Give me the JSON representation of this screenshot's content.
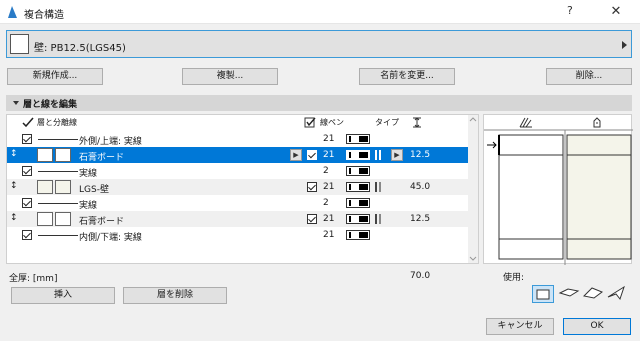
{
  "window": {
    "title": "複合構造",
    "help": "?",
    "close": "✕"
  },
  "selector": {
    "name": "壁: PB12.5(LGS45)"
  },
  "buttons": {
    "new": "新規作成...",
    "duplicate": "複製...",
    "rename": "名前を変更...",
    "delete": "削除..."
  },
  "section": {
    "title": "層と線を編集"
  },
  "columns": {
    "layer": "層と分離線",
    "pen": "線ペン",
    "type": "タイプ",
    "thickness_icon": "thickness-icon"
  },
  "rows": [
    {
      "kind": "line",
      "label": "外側/上端: 実線",
      "pen": "21"
    },
    {
      "kind": "layer",
      "label": "石膏ボード",
      "pen": "21",
      "thickness": "12.5"
    },
    {
      "kind": "line",
      "label": "実線",
      "pen": "2"
    },
    {
      "kind": "layer",
      "label": "LGS-壁",
      "pen": "21",
      "thickness": "45.0"
    },
    {
      "kind": "line",
      "label": "実線",
      "pen": "2"
    },
    {
      "kind": "layer",
      "label": "石膏ボード",
      "pen": "21",
      "thickness": "12.5"
    },
    {
      "kind": "line",
      "label": "内側/下端: 実線",
      "pen": "21"
    }
  ],
  "footer": {
    "total_label": "全厚: [mm]",
    "total_value": "70.0",
    "insert": "挿入",
    "delete_layer": "層を削除",
    "usage": "使用:"
  },
  "dialog": {
    "cancel": "キャンセル",
    "ok": "OK"
  },
  "colors": {
    "selection": "#0078d7",
    "accent_border": "#3c9ad8"
  }
}
